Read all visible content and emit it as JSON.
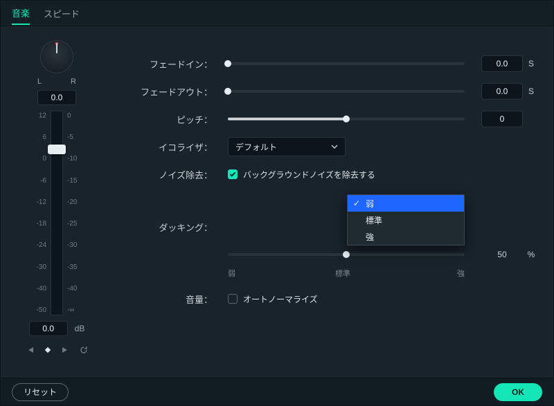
{
  "tabs": {
    "music": "音楽",
    "speed": "スピード"
  },
  "pan": {
    "L": "L",
    "R": "R",
    "value": "0.0"
  },
  "meter": {
    "leftScale": [
      "12",
      "6",
      "0",
      "-6",
      "-12",
      "-18",
      "-24",
      "-30",
      "-40",
      "-50"
    ],
    "rightScale": [
      "0",
      "-5",
      "-10",
      "-15",
      "-20",
      "-25",
      "-30",
      "-35",
      "-40",
      "-∞"
    ],
    "db_value": "0.0",
    "db_unit": "dB"
  },
  "rows": {
    "fadein": {
      "label": "フェードイン：",
      "value": "0.0",
      "unit": "S"
    },
    "fadeout": {
      "label": "フェードアウト：",
      "value": "0.0",
      "unit": "S"
    },
    "pitch": {
      "label": "ピッチ：",
      "value": "0"
    },
    "eq": {
      "label": "イコライザ：",
      "selected": "デフォルト"
    },
    "noise": {
      "label": "ノイズ除去：",
      "checkbox_label": "バックグラウンドノイズを除去する",
      "checked": true
    },
    "ducking": {
      "label": "ダッキング："
    },
    "strength": {
      "value": "50",
      "unit": "%",
      "ticks": {
        "low": "弱",
        "mid": "標準",
        "high": "強"
      }
    },
    "volume": {
      "label": "音量：",
      "checkbox_label": "オートノーマライズ",
      "checked": false
    }
  },
  "dropdown": {
    "options": [
      "弱",
      "標準",
      "強"
    ],
    "selected_index": 0
  },
  "footer": {
    "reset": "リセット",
    "ok": "OK"
  }
}
